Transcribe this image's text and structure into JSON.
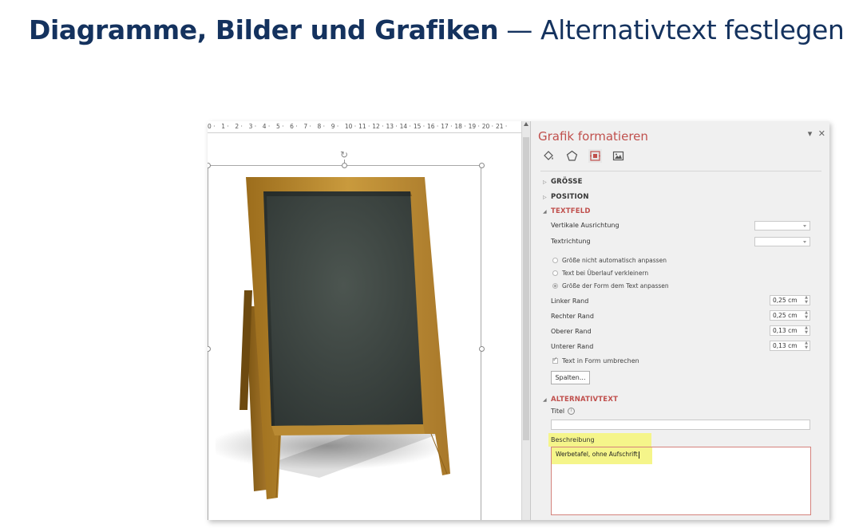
{
  "heading": {
    "bold": "Diagramme, Bilder und Grafiken",
    "rest": "— Alternativtext festlegen"
  },
  "ruler": [
    "0",
    "1",
    "2",
    "3",
    "4",
    "5",
    "6",
    "7",
    "8",
    "9",
    "10",
    "11",
    "12",
    "13",
    "14",
    "15",
    "16",
    "17",
    "18",
    "19",
    "20",
    "21"
  ],
  "pane": {
    "title": "Grafik formatieren",
    "pin": "▾",
    "close": "✕",
    "tabs": [
      "fill-line-icon",
      "effects-icon",
      "size-properties-icon",
      "picture-icon"
    ],
    "sections": {
      "groesse": "GRÖSSE",
      "position": "POSITION",
      "textfeld": "TEXTFELD",
      "alternativtext": "ALTERNATIVTEXT"
    },
    "textfeld": {
      "vertikale_ausrichtung": "Vertikale Ausrichtung",
      "textrichtung": "Textrichtung",
      "radio_1": "Größe nicht automatisch anpassen",
      "radio_2": "Text bei Überlauf verkleinern",
      "radio_3": "Größe der Form dem Text anpassen",
      "linker_rand": "Linker Rand",
      "linker_rand_value": "0,25 cm",
      "rechter_rand": "Rechter Rand",
      "rechter_rand_value": "0,25 cm",
      "oberer_rand": "Oberer Rand",
      "oberer_rand_value": "0,13 cm",
      "unterer_rand": "Unterer Rand",
      "unterer_rand_value": "0,13 cm",
      "wrap_checkbox": "Text in Form umbrechen",
      "spalten_button": "Spalten..."
    },
    "alternativtext": {
      "titel_label": "Titel",
      "titel_value": "",
      "beschreibung_label": "Beschreibung",
      "beschreibung_value": "Werbetafel, ohne Aufschrift"
    }
  },
  "colors": {
    "heading": "#14325e",
    "accent": "#c0504d",
    "highlight": "#f5f58a"
  }
}
